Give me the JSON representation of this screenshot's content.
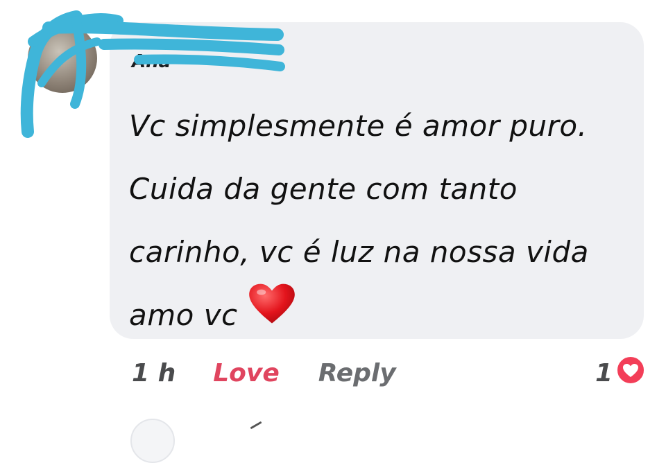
{
  "comment": {
    "author_name": "Ana",
    "text": "Vc simplesmente é amor puro. Cuida da gente com tanto carinho, vc é luz na nossa vida amo vc",
    "emoji": "heart-emoji"
  },
  "actions": {
    "time": "1 h",
    "love_label": "Love",
    "reply_label": "Reply"
  },
  "reactions": {
    "count": "1",
    "icon": "love-reaction-icon"
  },
  "colors": {
    "bubble": "#eff0f3",
    "love": "#e0455f",
    "reaction_red": "#f33e58",
    "redaction_scribble": "#3fb5d9"
  }
}
